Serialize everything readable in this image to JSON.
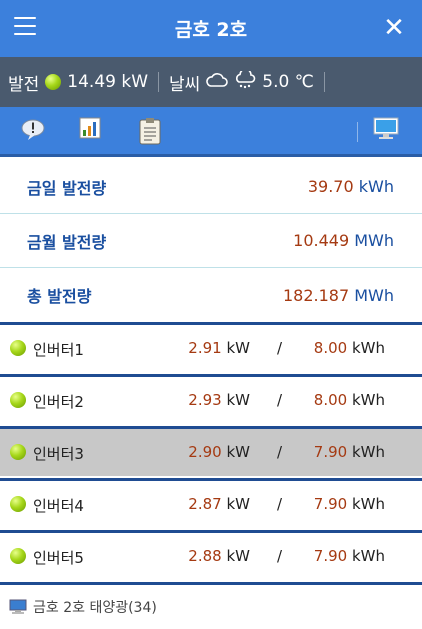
{
  "header": {
    "title": "금호 2호"
  },
  "status": {
    "gen_label": "발전",
    "gen_value": "14.49 kW",
    "weather_label": "날씨",
    "temperature": "5.0 ℃",
    "icons": [
      "status-dot-green",
      "cloud-icon",
      "snow-cloud-icon"
    ]
  },
  "toolbar": {
    "icons": [
      "alert-bubble-icon",
      "bar-chart-icon",
      "clipboard-icon",
      "monitor-icon"
    ]
  },
  "summary": [
    {
      "label": "금일 발전량",
      "value": "39.70",
      "unit": "kWh"
    },
    {
      "label": "금월 발전량",
      "value": "10.449",
      "unit": "MWh"
    },
    {
      "label": "총 발전량",
      "value": "182.187",
      "unit": "MWh"
    }
  ],
  "inverters": [
    {
      "name": "인버터1",
      "power": "2.91",
      "power_unit": "kW",
      "sep": "/",
      "energy": "8.00",
      "energy_unit": "kWh"
    },
    {
      "name": "인버터2",
      "power": "2.93",
      "power_unit": "kW",
      "sep": "/",
      "energy": "8.00",
      "energy_unit": "kWh"
    },
    {
      "name": "인버터3",
      "power": "2.90",
      "power_unit": "kW",
      "sep": "/",
      "energy": "7.90",
      "energy_unit": "kWh"
    },
    {
      "name": "인버터4",
      "power": "2.87",
      "power_unit": "kW",
      "sep": "/",
      "energy": "7.90",
      "energy_unit": "kWh"
    },
    {
      "name": "인버터5",
      "power": "2.88",
      "power_unit": "kW",
      "sep": "/",
      "energy": "7.90",
      "energy_unit": "kWh"
    }
  ],
  "selected_inverter": "인버터3",
  "footer": {
    "text": "금호 2호 태양광(34)"
  },
  "colors": {
    "header_blue": "#3c80dc",
    "status_bar": "#4a5a6e",
    "value_red": "#a53a12",
    "label_blue": "#1a4fa0",
    "status_green": "#a6d71a"
  }
}
